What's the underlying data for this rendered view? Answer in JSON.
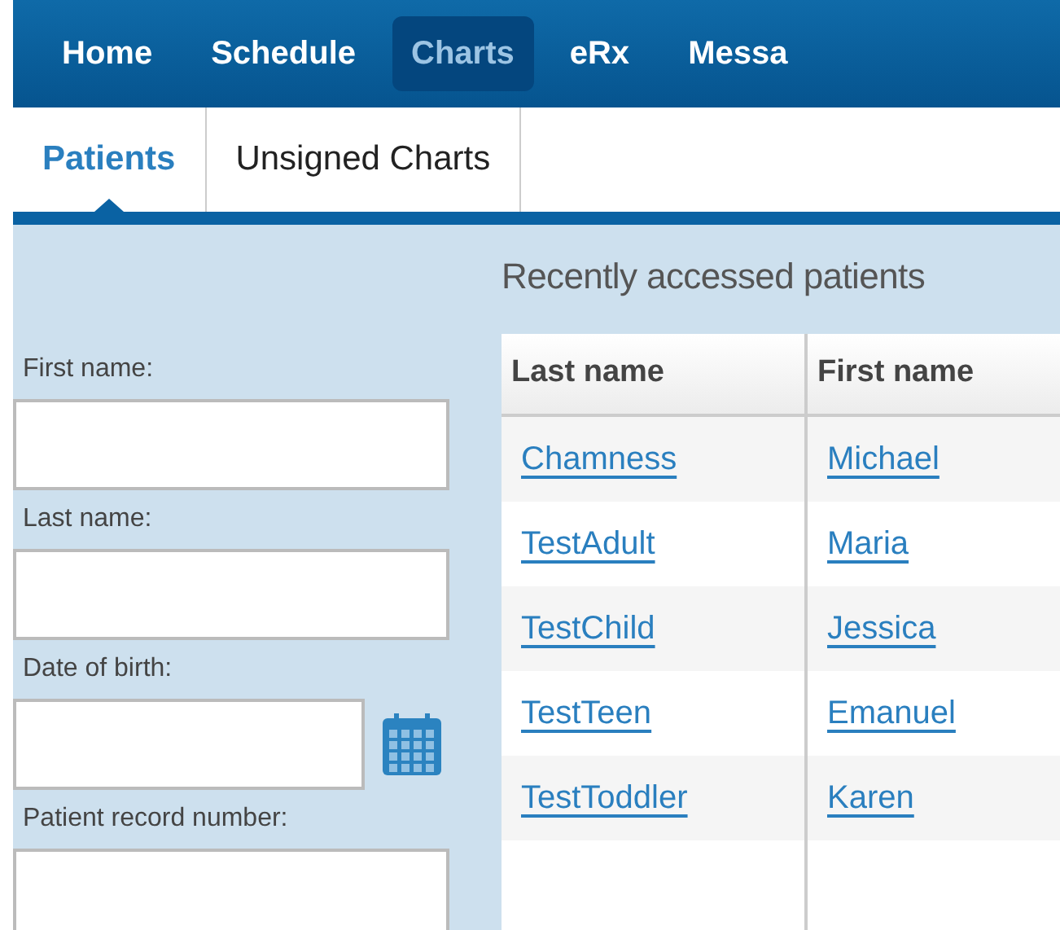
{
  "nav": [
    {
      "label": "Home",
      "selected": false
    },
    {
      "label": "Schedule",
      "selected": false
    },
    {
      "label": "Charts",
      "selected": true
    },
    {
      "label": "eRx",
      "selected": false
    },
    {
      "label": "Messa",
      "selected": false
    }
  ],
  "tabs": [
    {
      "label": "Patients",
      "selected": true
    },
    {
      "label": "Unsigned Charts",
      "selected": false
    }
  ],
  "search_form": {
    "fields": [
      {
        "label": "First name:",
        "kind": "text"
      },
      {
        "label": "Last name:",
        "kind": "text"
      },
      {
        "label": "Date of birth:",
        "kind": "date"
      },
      {
        "label": "Patient record number:",
        "kind": "text"
      }
    ]
  },
  "recent": {
    "title": "Recently accessed patients",
    "columns": [
      "Last name",
      "First name"
    ],
    "rows": [
      [
        "Chamness",
        "Michael"
      ],
      [
        "TestAdult",
        "Maria"
      ],
      [
        "TestChild",
        "Jessica"
      ],
      [
        "TestTeen",
        "Emanuel"
      ],
      [
        "TestToddler",
        "Karen"
      ]
    ]
  }
}
